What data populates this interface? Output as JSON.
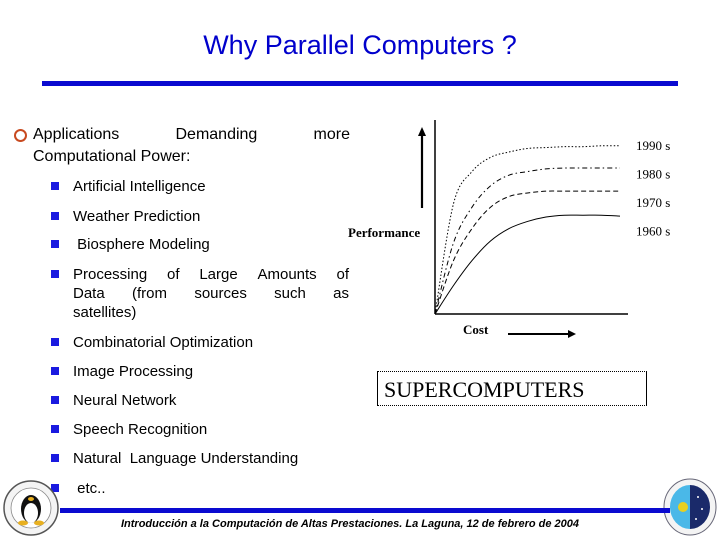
{
  "slide": {
    "title": "Why Parallel Computers ?",
    "main_point": {
      "words_line1": [
        "Applications",
        "Demanding",
        "more"
      ],
      "line2": "Computational Power:"
    },
    "sub_items": [
      "Artificial Intelligence",
      "Weather Prediction",
      " Biosphere Modeling",
      "Processing of Large Amounts of Data (from sources such as satellites)",
      "Combinatorial Optimization",
      "Image Processing",
      "Neural Network",
      "Speech Recognition",
      "Natural  Language Understanding",
      " etc.."
    ],
    "processing_lines": [
      [
        "Processing",
        "of",
        "Large",
        "Amounts",
        "of"
      ],
      [
        "Data",
        "(from",
        "sources",
        "such",
        "as"
      ],
      [
        "satellites)"
      ]
    ],
    "footer": "Introducción a la Computación de Altas Prestaciones. La Laguna, 12 de febrero de 2004",
    "boxed_label": "SUPERCOMPUTERS",
    "colors": {
      "title": "#0000cc",
      "rule": "#0a0ad0",
      "square_bullet": "#1a1ae0",
      "circle_bullet": "#c84a20"
    },
    "logos": {
      "left": "penguin-university-seal",
      "right": "astrophysics-institute-seal"
    }
  },
  "chart_data": {
    "type": "line",
    "title": "",
    "xlabel": "Cost",
    "ylabel": "Performance",
    "x": [
      0,
      0.1,
      0.2,
      0.3,
      0.4,
      0.5,
      0.6,
      0.7,
      0.8,
      0.9,
      1.0
    ],
    "xlim": [
      0,
      1
    ],
    "ylim": [
      0,
      1
    ],
    "grid": false,
    "legend": "right",
    "series": [
      {
        "name": "1990 s",
        "style": "dotted",
        "values": [
          0,
          0.62,
          0.8,
          0.88,
          0.91,
          0.93,
          0.935,
          0.94,
          0.94,
          0.945,
          0.945
        ]
      },
      {
        "name": "1980 s",
        "style": "dash-dot",
        "values": [
          0,
          0.4,
          0.6,
          0.72,
          0.78,
          0.8,
          0.815,
          0.82,
          0.82,
          0.82,
          0.82
        ]
      },
      {
        "name": "1970 s",
        "style": "dashed",
        "values": [
          0,
          0.3,
          0.48,
          0.6,
          0.66,
          0.68,
          0.69,
          0.69,
          0.69,
          0.69,
          0.69
        ]
      },
      {
        "name": "1960 s",
        "style": "solid",
        "values": [
          0,
          0.16,
          0.3,
          0.41,
          0.48,
          0.52,
          0.545,
          0.555,
          0.555,
          0.555,
          0.55
        ]
      }
    ]
  }
}
